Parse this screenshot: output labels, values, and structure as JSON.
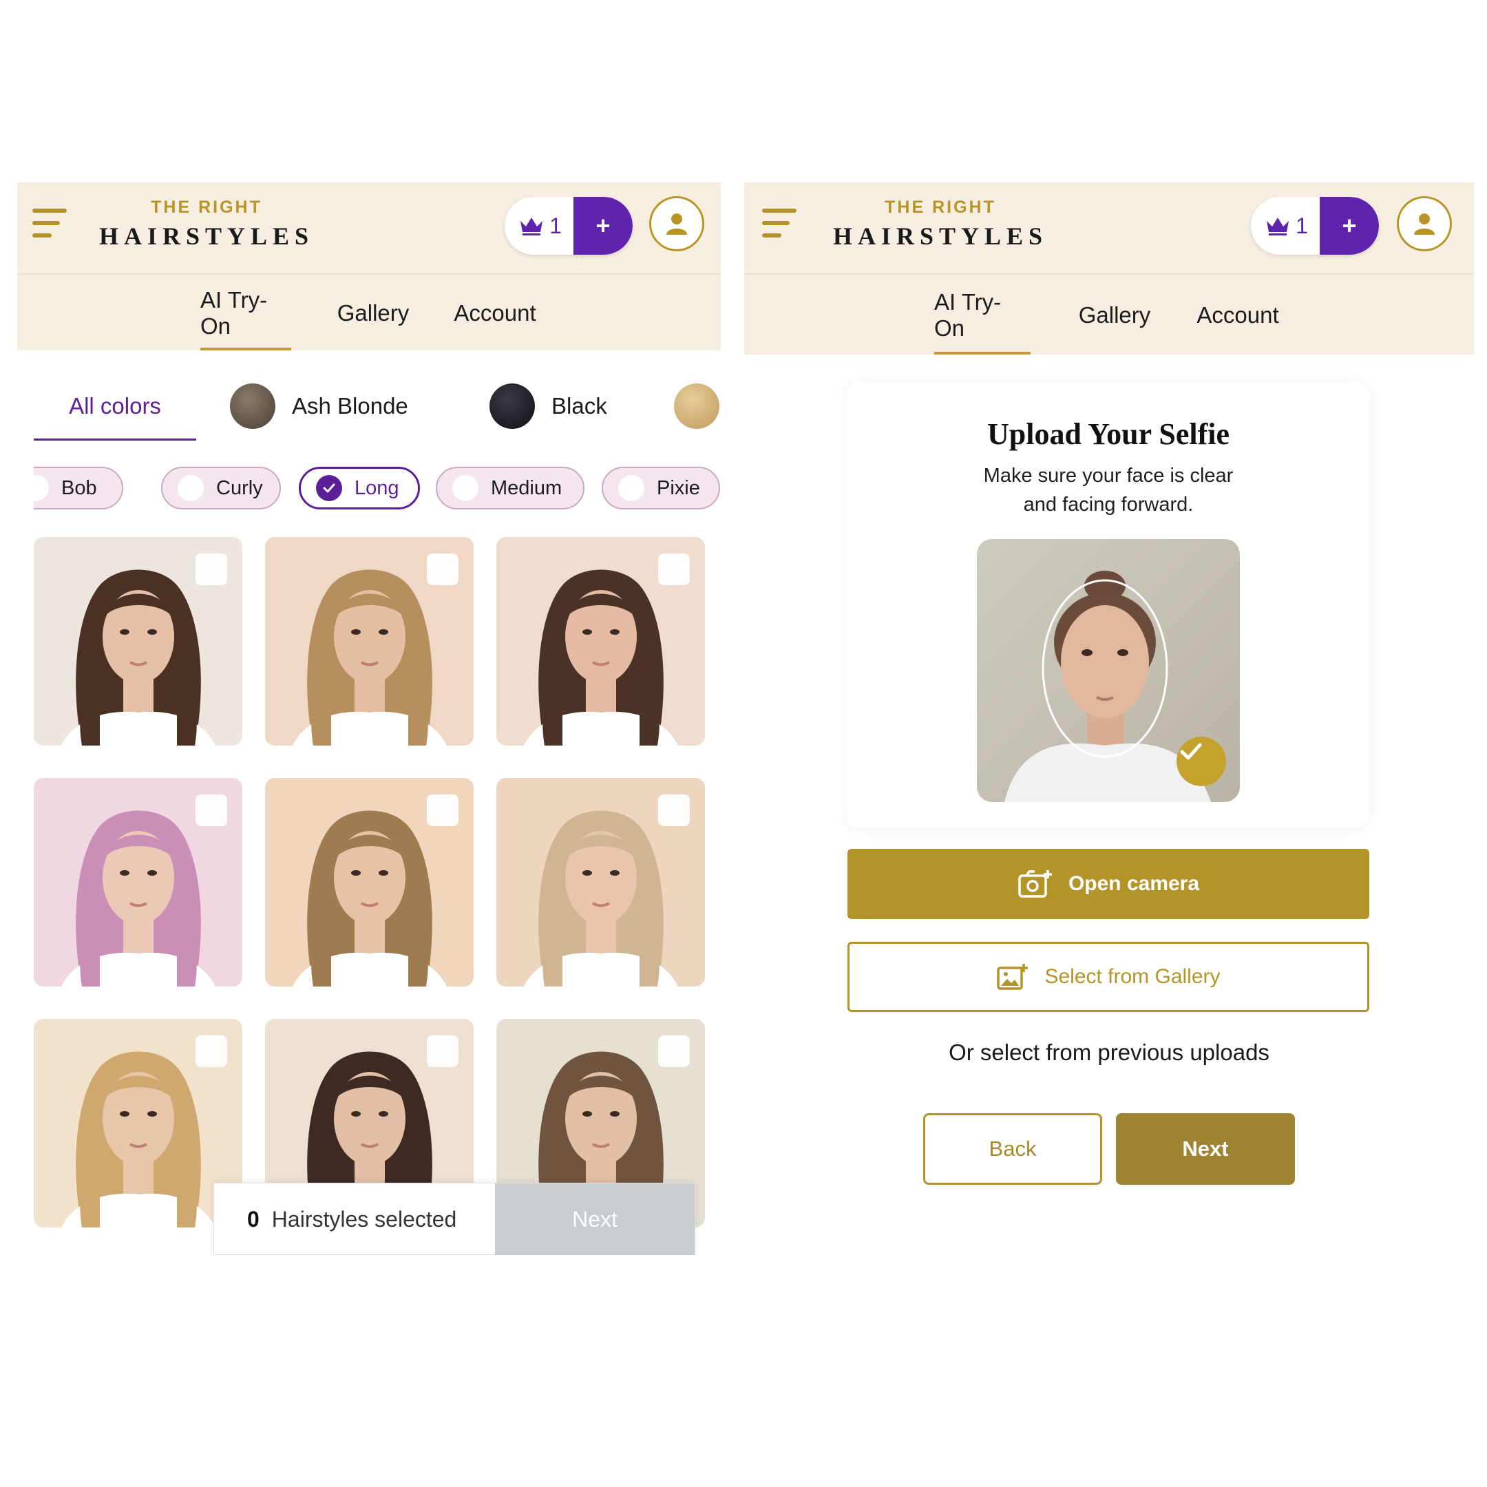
{
  "header": {
    "logo_top": "THE RIGHT",
    "logo_main": "HAIRSTYLES",
    "credit_count": "1",
    "credit_icon": "crown-icon",
    "add_label": "+",
    "brand_color": "#b89427",
    "accent_color": "#5e24ad"
  },
  "nav": {
    "tabs": [
      {
        "label": "AI Try-On",
        "active": true
      },
      {
        "label": "Gallery",
        "active": false
      },
      {
        "label": "Account",
        "active": false
      }
    ]
  },
  "left": {
    "color_filters": [
      {
        "label": "All colors",
        "active": true
      },
      {
        "label": "Ash Blonde",
        "swatch": "#5a5046"
      },
      {
        "label": "Black",
        "swatch": "#1c1c24"
      },
      {
        "label": "",
        "swatch": "#d3b27a"
      }
    ],
    "style_chips": [
      {
        "label": "Bob",
        "selected": false
      },
      {
        "label": "Curly",
        "selected": false
      },
      {
        "label": "Long",
        "selected": true
      },
      {
        "label": "Medium",
        "selected": false
      },
      {
        "label": "Pixie",
        "selected": false
      }
    ],
    "hairstyle_cards": [
      {
        "hair": "#4a3124",
        "bg": "#ece6df",
        "skin": "#e6c1a8",
        "checked": false
      },
      {
        "hair": "#b58f5e",
        "bg": "#efd9c6",
        "skin": "#e5bfa2",
        "checked": false
      },
      {
        "hair": "#4b3226",
        "bg": "#f0ddd0",
        "skin": "#e5bca3",
        "checked": false
      },
      {
        "hair": "#c98fb6",
        "bg": "#f1d7e2",
        "skin": "#ecc9b6",
        "checked": false
      },
      {
        "hair": "#9f7c4f",
        "bg": "#efd6bd",
        "skin": "#e8c2a7",
        "checked": false
      },
      {
        "hair": "#cfb592",
        "bg": "#eed5c0",
        "skin": "#e8c5ac",
        "checked": false
      },
      {
        "hair": "#cfa870",
        "bg": "#f2e1cb",
        "skin": "#e8c6aa",
        "checked": false
      },
      {
        "hair": "#3e2a22",
        "bg": "#efe0d1",
        "skin": "#e3bfa6",
        "checked": false
      },
      {
        "hair": "#6f5440",
        "bg": "#e6e0d2",
        "skin": "#e3bfa6",
        "checked": false
      }
    ],
    "selection": {
      "count": "0",
      "label": "Hairstyles selected",
      "next_label": "Next"
    }
  },
  "right": {
    "upload_title": "Upload Your Selfie",
    "upload_subtitle": "Make sure your face is clear and facing forward.",
    "open_camera_label": "Open camera",
    "open_camera_icon": "camera-icon",
    "select_gallery_label": "Select from Gallery",
    "select_gallery_icon": "image-add-icon",
    "previous_uploads_label": "Or select from previous uploads",
    "back_label": "Back",
    "next_label": "Next"
  }
}
